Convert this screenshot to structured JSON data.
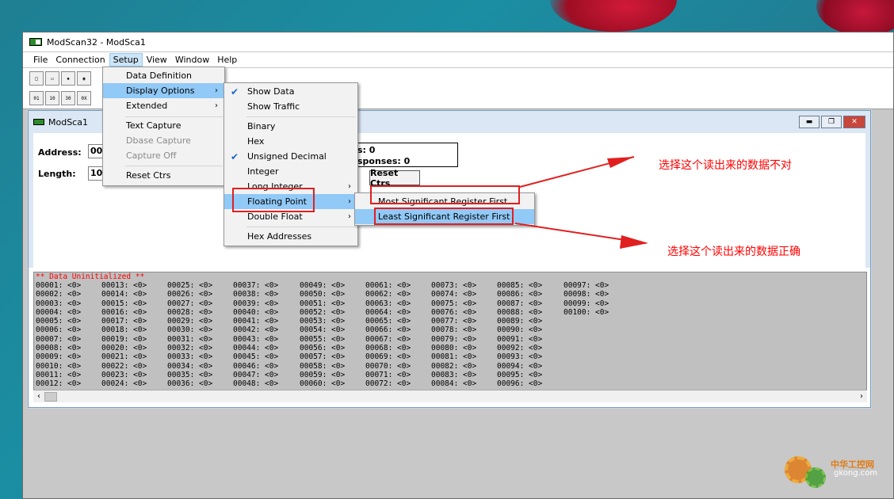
{
  "window": {
    "title": "ModScan32 - ModSca1"
  },
  "menubar": [
    "File",
    "Connection",
    "Setup",
    "View",
    "Window",
    "Help"
  ],
  "mdi": {
    "title": "ModSca1"
  },
  "form": {
    "address_label": "Address:",
    "address_value": "000",
    "length_label": "Length:",
    "length_value": "100",
    "stat_line1": "s: 0",
    "stat_line2": "sponses: 0",
    "reset_button": "Reset Ctrs"
  },
  "setup_menu": {
    "items": [
      "Data Definition",
      "Display Options",
      "Extended",
      "Text Capture",
      "Dbase Capture",
      "Capture Off",
      "Reset Ctrs"
    ]
  },
  "display_menu": {
    "items": [
      "Show Data",
      "Show Traffic",
      "Binary",
      "Hex",
      "Unsigned Decimal",
      "Integer",
      "Long Integer",
      "Floating Point",
      "Double Float",
      "Hex Addresses"
    ]
  },
  "float_menu": {
    "items": [
      "Most Significant Register First",
      "Least Significant Register First"
    ]
  },
  "annotations": {
    "wrong": "选择这个读出来的数据不对",
    "right": "选择这个读出来的数据正确"
  },
  "data_area": {
    "header": "** Data Uninitialized **",
    "columns": [
      [
        "00001: <0>",
        "00002: <0>",
        "00003: <0>",
        "00004: <0>",
        "00005: <0>",
        "00006: <0>",
        "00007: <0>",
        "00008: <0>",
        "00009: <0>",
        "00010: <0>",
        "00011: <0>",
        "00012: <0>"
      ],
      [
        "00013: <0>",
        "00014: <0>",
        "00015: <0>",
        "00016: <0>",
        "00017: <0>",
        "00018: <0>",
        "00019: <0>",
        "00020: <0>",
        "00021: <0>",
        "00022: <0>",
        "00023: <0>",
        "00024: <0>"
      ],
      [
        "00025: <0>",
        "00026: <0>",
        "00027: <0>",
        "00028: <0>",
        "00029: <0>",
        "00030: <0>",
        "00031: <0>",
        "00032: <0>",
        "00033: <0>",
        "00034: <0>",
        "00035: <0>",
        "00036: <0>"
      ],
      [
        "00037: <0>",
        "00038: <0>",
        "00039: <0>",
        "00040: <0>",
        "00041: <0>",
        "00042: <0>",
        "00043: <0>",
        "00044: <0>",
        "00045: <0>",
        "00046: <0>",
        "00047: <0>",
        "00048: <0>"
      ],
      [
        "00049: <0>",
        "00050: <0>",
        "00051: <0>",
        "00052: <0>",
        "00053: <0>",
        "00054: <0>",
        "00055: <0>",
        "00056: <0>",
        "00057: <0>",
        "00058: <0>",
        "00059: <0>",
        "00060: <0>"
      ],
      [
        "00061: <0>",
        "00062: <0>",
        "00063: <0>",
        "00064: <0>",
        "00065: <0>",
        "00066: <0>",
        "00067: <0>",
        "00068: <0>",
        "00069: <0>",
        "00070: <0>",
        "00071: <0>",
        "00072: <0>"
      ],
      [
        "00073: <0>",
        "00074: <0>",
        "00075: <0>",
        "00076: <0>",
        "00077: <0>",
        "00078: <0>",
        "00079: <0>",
        "00080: <0>",
        "00081: <0>",
        "00082: <0>",
        "00083: <0>",
        "00084: <0>"
      ],
      [
        "00085: <0>",
        "00086: <0>",
        "00087: <0>",
        "00088: <0>",
        "00089: <0>",
        "00090: <0>",
        "00091: <0>",
        "00092: <0>",
        "00093: <0>",
        "00094: <0>",
        "00095: <0>",
        "00096: <0>"
      ],
      [
        "00097: <0>",
        "00098: <0>",
        "00099: <0>",
        "00100: <0>"
      ]
    ]
  },
  "watermark": {
    "brand": "中华工控网",
    "url": "gkong.com"
  },
  "colors": {
    "highlight": "#91c9f7",
    "annotation": "#ff0000",
    "data_bg": "#c0c0c0"
  }
}
